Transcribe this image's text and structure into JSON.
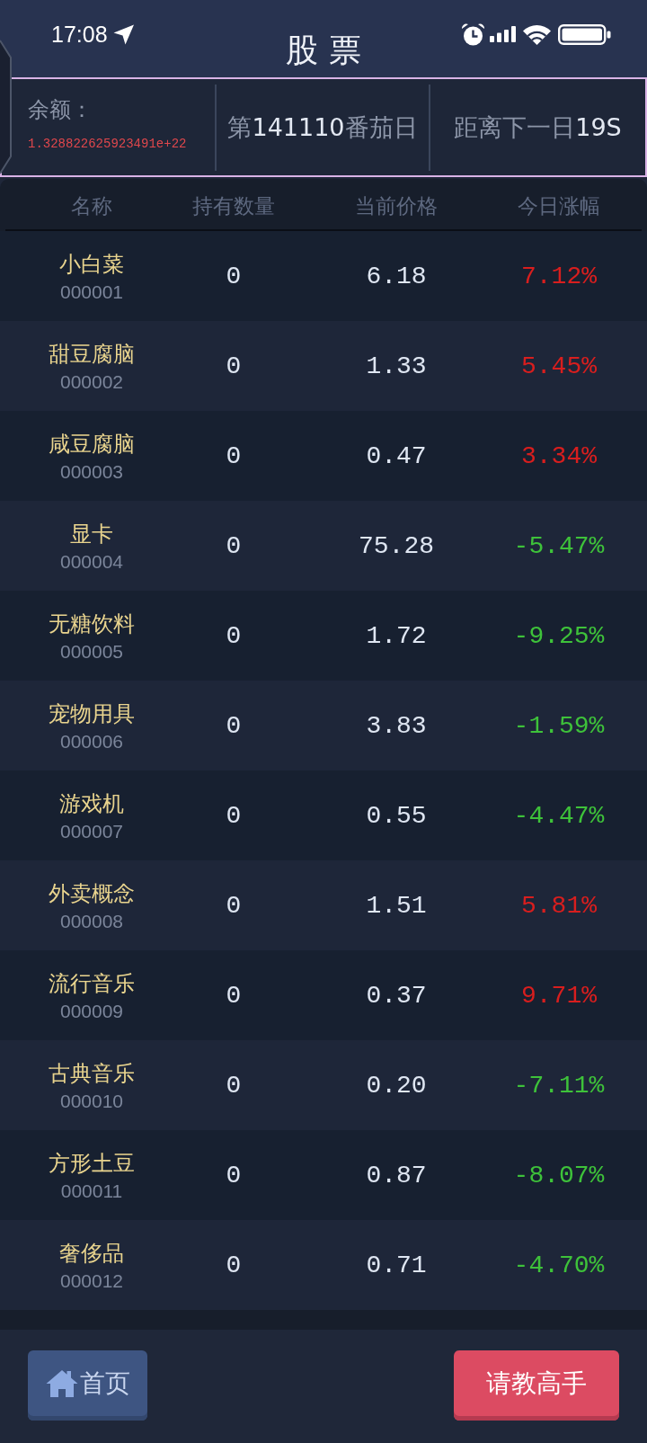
{
  "status_bar": {
    "time": "17:08"
  },
  "header": {
    "title": "股 票"
  },
  "info_bar": {
    "balance_label": "余额：",
    "balance": "1.328822625923491e+22",
    "day": {
      "prefix": "第",
      "number": "141110",
      "suffix": "番茄日"
    },
    "countdown": {
      "prefix": "距离下一日",
      "value": "19S"
    }
  },
  "table": {
    "columns": [
      "名称",
      "持有数量",
      "当前价格",
      "今日涨幅"
    ],
    "rows": [
      {
        "name": "小白菜",
        "code": "000001",
        "quantity": "0",
        "price": "6.18",
        "change": "7.12%",
        "color": "#d81e1e"
      },
      {
        "name": "甜豆腐脑",
        "code": "000002",
        "quantity": "0",
        "price": "1.33",
        "change": "5.45%",
        "color": "#d81e1e"
      },
      {
        "name": "咸豆腐脑",
        "code": "000003",
        "quantity": "0",
        "price": "0.47",
        "change": "3.34%",
        "color": "#d81e1e"
      },
      {
        "name": "显卡",
        "code": "000004",
        "quantity": "0",
        "price": "75.28",
        "change": "-5.47%",
        "color": "#3ec23a"
      },
      {
        "name": "无糖饮料",
        "code": "000005",
        "quantity": "0",
        "price": "1.72",
        "change": "-9.25%",
        "color": "#3ec23a"
      },
      {
        "name": "宠物用具",
        "code": "000006",
        "quantity": "0",
        "price": "3.83",
        "change": "-1.59%",
        "color": "#3ec23a"
      },
      {
        "name": "游戏机",
        "code": "000007",
        "quantity": "0",
        "price": "0.55",
        "change": "-4.47%",
        "color": "#3ec23a"
      },
      {
        "name": "外卖概念",
        "code": "000008",
        "quantity": "0",
        "price": "1.51",
        "change": "5.81%",
        "color": "#d81e1e"
      },
      {
        "name": "流行音乐",
        "code": "000009",
        "quantity": "0",
        "price": "0.37",
        "change": "9.71%",
        "color": "#d81e1e"
      },
      {
        "name": "古典音乐",
        "code": "000010",
        "quantity": "0",
        "price": "0.20",
        "change": "-7.11%",
        "color": "#3ec23a"
      },
      {
        "name": "方形土豆",
        "code": "000011",
        "quantity": "0",
        "price": "0.87",
        "change": "-8.07%",
        "color": "#3ec23a"
      },
      {
        "name": "奢侈品",
        "code": "000012",
        "quantity": "0",
        "price": "0.71",
        "change": "-4.70%",
        "color": "#3ec23a"
      }
    ]
  },
  "footer": {
    "buttons": [
      {
        "label": "首页",
        "kind": "home"
      },
      {
        "label": "请教高手",
        "kind": "primary"
      }
    ]
  }
}
